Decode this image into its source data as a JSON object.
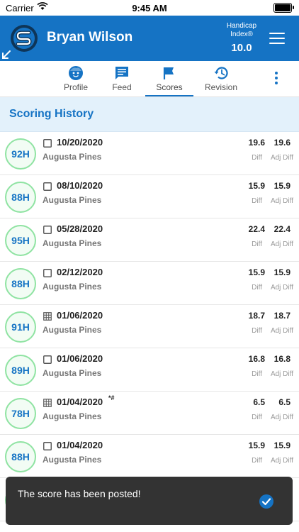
{
  "status_bar": {
    "carrier": "Carrier",
    "time": "9:45 AM"
  },
  "header": {
    "user_name": "Bryan Wilson",
    "handicap_label": "Handicap Index®",
    "handicap_value": "10.0",
    "brand_color": "#1573c4"
  },
  "tabs": [
    {
      "label": "Profile",
      "icon": "face-icon"
    },
    {
      "label": "Feed",
      "icon": "feed-icon"
    },
    {
      "label": "Scores",
      "icon": "flag-icon",
      "active": true
    },
    {
      "label": "Revision",
      "icon": "history-icon"
    }
  ],
  "section": {
    "title": "Scoring History"
  },
  "scores": [
    {
      "score": "92H",
      "type": "checkbox",
      "date": "10/20/2020",
      "marker": "",
      "course": "Augusta Pines",
      "diff": "19.6",
      "adj_diff": "19.6",
      "diff_label": "Diff",
      "adj_label": "Adj Diff"
    },
    {
      "score": "88H",
      "type": "checkbox",
      "date": "08/10/2020",
      "marker": "",
      "course": "Augusta Pines",
      "diff": "15.9",
      "adj_diff": "15.9",
      "diff_label": "Diff",
      "adj_label": "Adj Diff"
    },
    {
      "score": "95H",
      "type": "checkbox",
      "date": "05/28/2020",
      "marker": "",
      "course": "Augusta Pines",
      "diff": "22.4",
      "adj_diff": "22.4",
      "diff_label": "Diff",
      "adj_label": "Adj Diff"
    },
    {
      "score": "88H",
      "type": "checkbox",
      "date": "02/12/2020",
      "marker": "",
      "course": "Augusta Pines",
      "diff": "15.9",
      "adj_diff": "15.9",
      "diff_label": "Diff",
      "adj_label": "Adj Diff"
    },
    {
      "score": "91H",
      "type": "grid",
      "date": "01/06/2020",
      "marker": "",
      "course": "Augusta Pines",
      "diff": "18.7",
      "adj_diff": "18.7",
      "diff_label": "Diff",
      "adj_label": "Adj Diff"
    },
    {
      "score": "89H",
      "type": "checkbox",
      "date": "01/06/2020",
      "marker": "",
      "course": "Augusta Pines",
      "diff": "16.8",
      "adj_diff": "16.8",
      "diff_label": "Diff",
      "adj_label": "Adj Diff"
    },
    {
      "score": "78H",
      "type": "grid",
      "date": "01/04/2020",
      "marker": "*#",
      "course": "Augusta Pines",
      "diff": "6.5",
      "adj_diff": "6.5",
      "diff_label": "Diff",
      "adj_label": "Adj Diff"
    },
    {
      "score": "88H",
      "type": "checkbox",
      "date": "01/04/2020",
      "marker": "",
      "course": "Augusta Pines",
      "diff": "15.9",
      "adj_diff": "15.9",
      "diff_label": "Diff",
      "adj_label": "Adj Diff"
    }
  ],
  "toast": {
    "message": "The score has been posted!"
  }
}
